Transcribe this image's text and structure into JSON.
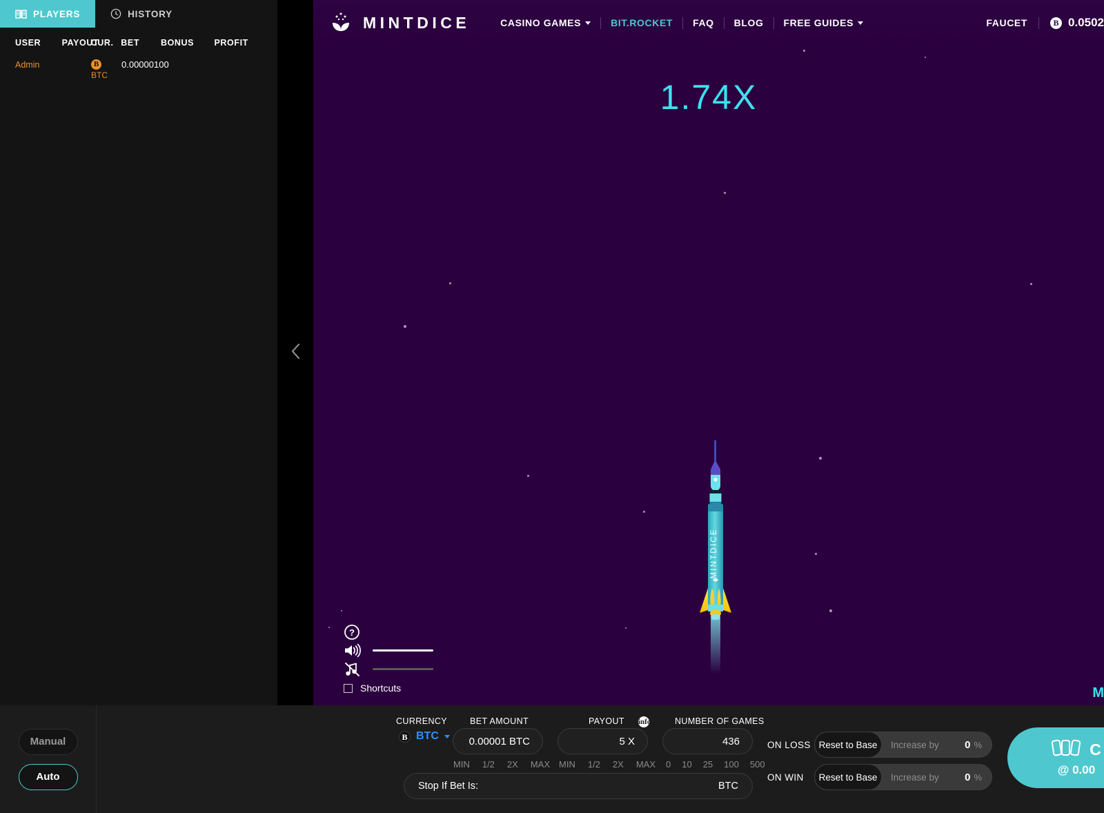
{
  "sidebar": {
    "tabs": [
      {
        "label": "PLAYERS",
        "icon": "book-icon",
        "active": true
      },
      {
        "label": "HISTORY",
        "icon": "clock-icon",
        "active": false
      }
    ],
    "columns": [
      "USER",
      "PAYOUT",
      "CUR.",
      "BET",
      "BONUS",
      "PROFIT"
    ],
    "rows": [
      {
        "user": "Admin",
        "payout": "",
        "cur_symbol": "B",
        "cur_code": "BTC",
        "bet": "0.00000100",
        "bonus": "",
        "profit": ""
      }
    ],
    "collapse_icon": "chevron-left-icon"
  },
  "topnav": {
    "brand": "MINTDICE",
    "brand_icon": "mintdice-logo-icon",
    "links": [
      {
        "label": "CASINO GAMES",
        "dropdown": true,
        "active": false
      },
      {
        "label": "BIT.ROCKET",
        "dropdown": false,
        "active": true
      },
      {
        "label": "FAQ",
        "dropdown": false,
        "active": false
      },
      {
        "label": "BLOG",
        "dropdown": false,
        "active": false
      },
      {
        "label": "FREE GUIDES",
        "dropdown": true,
        "active": false
      }
    ],
    "faucet": "FAUCET",
    "balance_symbol": "B",
    "balance": "0.0502"
  },
  "game": {
    "multiplier": "1.74X",
    "rocket_label": "MINTDICE",
    "bottom_right_text": "M",
    "overlay": {
      "help_icon": "question-mark-icon",
      "sound_icon": "speaker-on-icon",
      "sound_state": "on",
      "music_icon": "music-muted-icon",
      "music_state": "off",
      "shortcuts_label": "Shortcuts",
      "shortcuts_checked": false
    }
  },
  "controls": {
    "mode": {
      "manual": "Manual",
      "auto": "Auto",
      "active": "Auto"
    },
    "currency": {
      "label": "CURRENCY",
      "symbol": "B",
      "code": "BTC"
    },
    "bet_amount": {
      "label": "BET AMOUNT",
      "value": "0.00001 BTC",
      "quick": [
        "MIN",
        "1/2",
        "2X",
        "MAX"
      ]
    },
    "payout": {
      "label": "PAYOUT",
      "value": "5 X",
      "quick": [
        "MIN",
        "1/2",
        "2X",
        "MAX"
      ],
      "info_icon": "info-icon"
    },
    "number_of_games": {
      "label": "NUMBER OF GAMES",
      "value": "436",
      "quick": [
        "0",
        "10",
        "25",
        "100",
        "500"
      ]
    },
    "stop_if_bet": {
      "label": "Stop If Bet Is:",
      "value": "",
      "suffix": "BTC"
    },
    "on_loss": {
      "label": "ON LOSS",
      "reset": "Reset to Base",
      "increase_label": "Increase by",
      "increase_value": "0",
      "pct": "%"
    },
    "on_win": {
      "label": "ON WIN",
      "reset": "Reset to Base",
      "increase_label": "Increase by",
      "increase_value": "0",
      "pct": "%"
    },
    "cashout": {
      "label": "C",
      "sub": "@ 0.00",
      "icon": "cards-icon"
    }
  },
  "colors": {
    "accent": "#4ec8ce",
    "game_bg": "#2b003e",
    "multiplier": "#3ee0f0",
    "btc_orange": "#e8912a",
    "currency_blue": "#2f8fff"
  }
}
